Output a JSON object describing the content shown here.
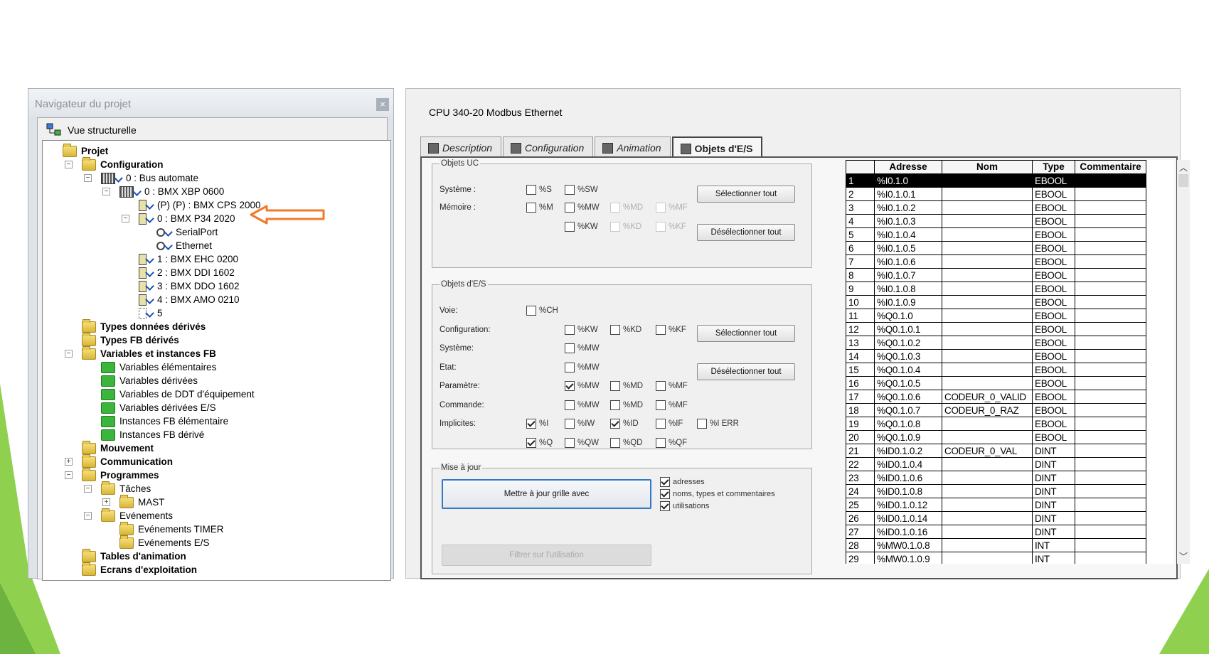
{
  "navigator": {
    "title": "Navigateur du projet",
    "close": "×",
    "view_label": "Vue structurelle",
    "tree": [
      {
        "label": "Projet",
        "bold": true,
        "icon": "folder"
      },
      {
        "label": "Configuration",
        "bold": true,
        "icon": "folder"
      },
      {
        "label": "0 : Bus automate",
        "bold": false,
        "icon": "bus"
      },
      {
        "label": "0 : BMX XBP 0600",
        "bold": false,
        "icon": "rack"
      },
      {
        "label": "(P) (P) : BMX CPS 2000",
        "bold": false,
        "icon": "module"
      },
      {
        "label": "0 : BMX P34 2020",
        "bold": false,
        "icon": "module"
      },
      {
        "label": "SerialPort",
        "bold": false,
        "icon": "network"
      },
      {
        "label": "Ethernet",
        "bold": false,
        "icon": "network"
      },
      {
        "label": "1 : BMX EHC 0200",
        "bold": false,
        "icon": "module"
      },
      {
        "label": "2 : BMX DDI 1602",
        "bold": false,
        "icon": "module"
      },
      {
        "label": "3 : BMX DDO 1602",
        "bold": false,
        "icon": "module"
      },
      {
        "label": "4 : BMX AMO 0210",
        "bold": false,
        "icon": "module"
      },
      {
        "label": "5",
        "bold": false,
        "icon": "slot"
      },
      {
        "label": "Types données dérivés",
        "bold": true,
        "icon": "folder"
      },
      {
        "label": "Types FB dérivés",
        "bold": true,
        "icon": "folder"
      },
      {
        "label": "Variables et instances FB",
        "bold": true,
        "icon": "folder"
      },
      {
        "label": "Variables élémentaires",
        "bold": false,
        "icon": "green"
      },
      {
        "label": "Variables dérivées",
        "bold": false,
        "icon": "green"
      },
      {
        "label": "Variables de DDT d'équipement",
        "bold": false,
        "icon": "green"
      },
      {
        "label": "Variables dérivées E/S",
        "bold": false,
        "icon": "green"
      },
      {
        "label": "Instances FB élémentaire",
        "bold": false,
        "icon": "green"
      },
      {
        "label": "Instances FB dérivé",
        "bold": false,
        "icon": "green"
      },
      {
        "label": "Mouvement",
        "bold": true,
        "icon": "folder"
      },
      {
        "label": "Communication",
        "bold": true,
        "icon": "folder"
      },
      {
        "label": "Programmes",
        "bold": true,
        "icon": "folder"
      },
      {
        "label": "Tâches",
        "bold": false,
        "icon": "folder"
      },
      {
        "label": "MAST",
        "bold": false,
        "icon": "folder"
      },
      {
        "label": "Evénements",
        "bold": false,
        "icon": "folder"
      },
      {
        "label": "Evénements TIMER",
        "bold": false,
        "icon": "folder"
      },
      {
        "label": "Evénements E/S",
        "bold": false,
        "icon": "folder"
      },
      {
        "label": "Tables d'animation",
        "bold": true,
        "icon": "folder"
      },
      {
        "label": "Ecrans d'exploitation",
        "bold": true,
        "icon": "folder"
      }
    ]
  },
  "main": {
    "title": "CPU 340-20 Modbus Ethernet",
    "tabs": [
      "Description",
      "Configuration",
      "Animation",
      "Objets d'E/S"
    ],
    "active_tab": "Objets d'E/S",
    "objets_uc": {
      "title": "Objets UC",
      "systeme_label": "Système :",
      "memoire_label": "Mémoire :",
      "systeme": [
        {
          "label": "%S",
          "checked": false,
          "enabled": true
        },
        {
          "label": "%SW",
          "checked": false,
          "enabled": true
        }
      ],
      "memoire_row1": [
        {
          "label": "%M",
          "checked": false,
          "enabled": true
        },
        {
          "label": "%MW",
          "checked": false,
          "enabled": true
        },
        {
          "label": "%MD",
          "checked": false,
          "enabled": false
        },
        {
          "label": "%MF",
          "checked": false,
          "enabled": false
        }
      ],
      "memoire_row2": [
        {
          "label": "%KW",
          "checked": false,
          "enabled": true
        },
        {
          "label": "%KD",
          "checked": false,
          "enabled": false
        },
        {
          "label": "%KF",
          "checked": false,
          "enabled": false
        }
      ],
      "select_all": "Sélectionner tout",
      "deselect_all": "Désélectionner tout"
    },
    "objets_es": {
      "title": "Objets d'E/S",
      "voie_label": "Voie:",
      "configuration_label": "Configuration:",
      "systeme_label": "Système:",
      "etat_label": "Etat:",
      "parametre_label": "Paramètre:",
      "commande_label": "Commande:",
      "implicites_label": "Implicites:",
      "voie": [
        {
          "label": "%CH",
          "checked": false
        }
      ],
      "configuration": [
        {
          "label": "%KW",
          "checked": false
        },
        {
          "label": "%KD",
          "checked": false
        },
        {
          "label": "%KF",
          "checked": false
        }
      ],
      "systeme": [
        {
          "label": "%MW",
          "checked": false
        }
      ],
      "etat": [
        {
          "label": "%MW",
          "checked": false
        }
      ],
      "parametre": [
        {
          "label": "%MW",
          "checked": true
        },
        {
          "label": "%MD",
          "checked": false
        },
        {
          "label": "%MF",
          "checked": false
        }
      ],
      "commande": [
        {
          "label": "%MW",
          "checked": false
        },
        {
          "label": "%MD",
          "checked": false
        },
        {
          "label": "%MF",
          "checked": false
        }
      ],
      "implicites_row1": [
        {
          "label": "%I",
          "checked": true
        },
        {
          "label": "%IW",
          "checked": false
        },
        {
          "label": "%ID",
          "checked": true
        },
        {
          "label": "%IF",
          "checked": false
        },
        {
          "label": "%I ERR",
          "checked": false
        }
      ],
      "implicites_row2": [
        {
          "label": "%Q",
          "checked": true
        },
        {
          "label": "%QW",
          "checked": false
        },
        {
          "label": "%QD",
          "checked": false
        },
        {
          "label": "%QF",
          "checked": false
        }
      ],
      "select_all": "Sélectionner tout",
      "deselect_all": "Désélectionner tout"
    },
    "mise_a_jour": {
      "title": "Mise à jour",
      "update_button": "Mettre à jour grille avec",
      "options": [
        {
          "label": "adresses",
          "checked": true
        },
        {
          "label": "noms, types et commentaires",
          "checked": true
        },
        {
          "label": "utilisations",
          "checked": true
        }
      ],
      "filter_button": "Filtrer sur l'utilisation"
    },
    "table": {
      "columns": [
        "",
        "Adresse",
        "Nom",
        "Type",
        "Commentaire"
      ],
      "rows": [
        [
          "1",
          "%I0.1.0",
          "",
          "EBOOL",
          ""
        ],
        [
          "2",
          "%I0.1.0.1",
          "",
          "EBOOL",
          ""
        ],
        [
          "3",
          "%I0.1.0.2",
          "",
          "EBOOL",
          ""
        ],
        [
          "4",
          "%I0.1.0.3",
          "",
          "EBOOL",
          ""
        ],
        [
          "5",
          "%I0.1.0.4",
          "",
          "EBOOL",
          ""
        ],
        [
          "6",
          "%I0.1.0.5",
          "",
          "EBOOL",
          ""
        ],
        [
          "7",
          "%I0.1.0.6",
          "",
          "EBOOL",
          ""
        ],
        [
          "8",
          "%I0.1.0.7",
          "",
          "EBOOL",
          ""
        ],
        [
          "9",
          "%I0.1.0.8",
          "",
          "EBOOL",
          ""
        ],
        [
          "10",
          "%I0.1.0.9",
          "",
          "EBOOL",
          ""
        ],
        [
          "11",
          "%Q0.1.0",
          "",
          "EBOOL",
          ""
        ],
        [
          "12",
          "%Q0.1.0.1",
          "",
          "EBOOL",
          ""
        ],
        [
          "13",
          "%Q0.1.0.2",
          "",
          "EBOOL",
          ""
        ],
        [
          "14",
          "%Q0.1.0.3",
          "",
          "EBOOL",
          ""
        ],
        [
          "15",
          "%Q0.1.0.4",
          "",
          "EBOOL",
          ""
        ],
        [
          "16",
          "%Q0.1.0.5",
          "",
          "EBOOL",
          ""
        ],
        [
          "17",
          "%Q0.1.0.6",
          "CODEUR_0_VALID",
          "EBOOL",
          ""
        ],
        [
          "18",
          "%Q0.1.0.7",
          "CODEUR_0_RAZ",
          "EBOOL",
          ""
        ],
        [
          "19",
          "%Q0.1.0.8",
          "",
          "EBOOL",
          ""
        ],
        [
          "20",
          "%Q0.1.0.9",
          "",
          "EBOOL",
          ""
        ],
        [
          "21",
          "%ID0.1.0.2",
          "CODEUR_0_VAL",
          "DINT",
          ""
        ],
        [
          "22",
          "%ID0.1.0.4",
          "",
          "DINT",
          ""
        ],
        [
          "23",
          "%ID0.1.0.6",
          "",
          "DINT",
          ""
        ],
        [
          "24",
          "%ID0.1.0.8",
          "",
          "DINT",
          ""
        ],
        [
          "25",
          "%ID0.1.0.12",
          "",
          "DINT",
          ""
        ],
        [
          "26",
          "%ID0.1.0.14",
          "",
          "DINT",
          ""
        ],
        [
          "27",
          "%ID0.1.0.16",
          "",
          "DINT",
          ""
        ],
        [
          "28",
          "%MW0.1.0.8",
          "",
          "INT",
          ""
        ],
        [
          "29",
          "%MW0.1.0.9",
          "",
          "INT",
          ""
        ]
      ],
      "selected_row": "1"
    }
  },
  "colors": {
    "accent_arrow": "#f07a2a",
    "slide_green": "#8fd14f",
    "selection": "#000000"
  }
}
